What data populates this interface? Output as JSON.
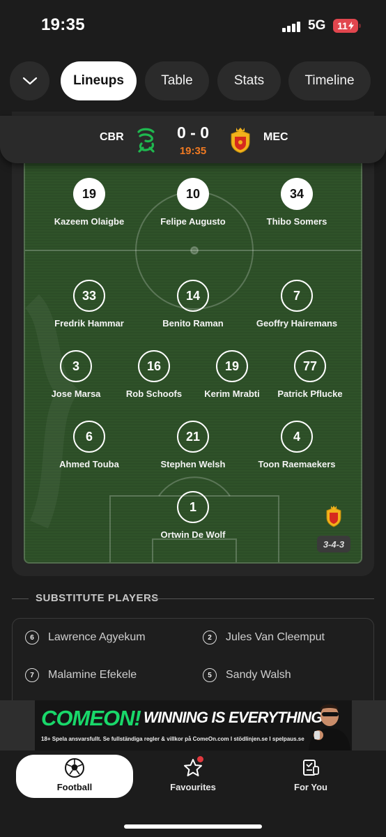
{
  "status_bar": {
    "time": "19:35",
    "network": "5G",
    "battery": "11"
  },
  "tabs": [
    {
      "label": "Lineups",
      "active": true
    },
    {
      "label": "Table",
      "active": false
    },
    {
      "label": "Stats",
      "active": false
    },
    {
      "label": "Timeline",
      "active": false
    }
  ],
  "match": {
    "home_code": "CBR",
    "away_code": "MEC",
    "score": "0 - 0",
    "time": "19:35"
  },
  "lineup": {
    "formation": "3-4-3",
    "opponent_front": [
      {
        "number": "19",
        "name": "Kazeem Olaigbe"
      },
      {
        "number": "10",
        "name": "Felipe Augusto"
      },
      {
        "number": "34",
        "name": "Thibo Somers"
      }
    ],
    "forwards": [
      {
        "number": "33",
        "name": "Fredrik Hammar"
      },
      {
        "number": "14",
        "name": "Benito Raman"
      },
      {
        "number": "7",
        "name": "Geoffry Hairemans"
      }
    ],
    "midfielders": [
      {
        "number": "3",
        "name": "Jose Marsa"
      },
      {
        "number": "16",
        "name": "Rob Schoofs"
      },
      {
        "number": "19",
        "name": "Kerim Mrabti"
      },
      {
        "number": "77",
        "name": "Patrick Pflucke"
      }
    ],
    "defenders": [
      {
        "number": "6",
        "name": "Ahmed Touba"
      },
      {
        "number": "21",
        "name": "Stephen Welsh"
      },
      {
        "number": "4",
        "name": "Toon Raemaekers"
      }
    ],
    "goalkeeper": {
      "number": "1",
      "name": "Ortwin De Wolf"
    }
  },
  "substitutes": {
    "heading": "SUBSTITUTE PLAYERS",
    "players": [
      {
        "number": "6",
        "name": "Lawrence Agyekum"
      },
      {
        "number": "2",
        "name": "Jules Van Cleemput"
      },
      {
        "number": "7",
        "name": "Malamine Efekele"
      },
      {
        "number": "5",
        "name": "Sandy Walsh"
      }
    ]
  },
  "ad": {
    "brand": "COMEON!",
    "tagline": "WINNING IS EVERYTHING.",
    "disclaimer": "18+ Spela ansvarsfullt. Se fullständiga regler & villkor på ComeOn.com I stödlinjen.se I spelpaus.se"
  },
  "bottom_nav": [
    {
      "label": "Football",
      "icon": "football-icon",
      "active": true
    },
    {
      "label": "Favourites",
      "icon": "star-icon",
      "active": false,
      "notification": true
    },
    {
      "label": "For You",
      "icon": "for-you-icon",
      "active": false
    }
  ],
  "colors": {
    "accent_orange": "#f07a22",
    "home_green": "#1fb84f",
    "away_red": "#d62a1e",
    "away_gold": "#f2b21b",
    "ad_green": "#19d86a"
  }
}
